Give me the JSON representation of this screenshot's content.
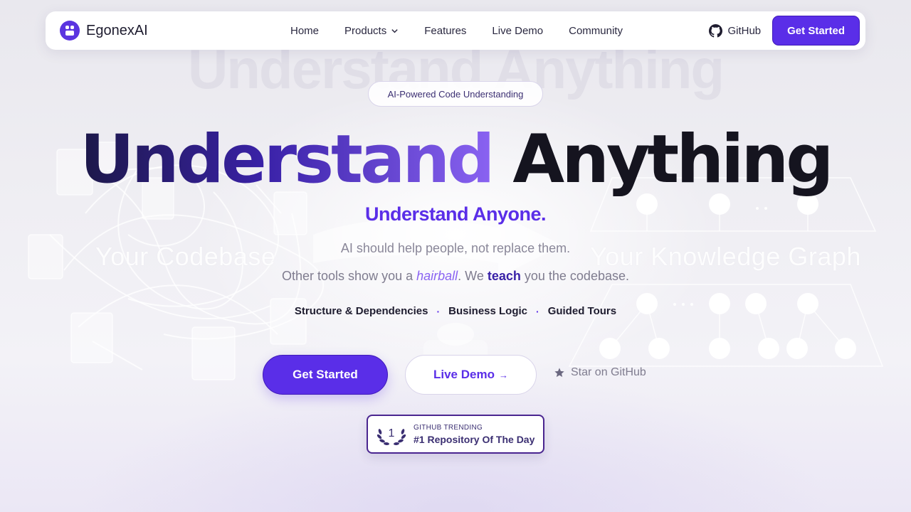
{
  "nav": {
    "brand": "EgonexAI",
    "links": [
      {
        "label": "Home"
      },
      {
        "label": "Products",
        "has_dropdown": true
      },
      {
        "label": "Features"
      },
      {
        "label": "Live Demo"
      },
      {
        "label": "Community"
      }
    ],
    "github_label": "GitHub",
    "cta_label": "Get Started"
  },
  "background": {
    "left_label": "Your Codebase",
    "right_label": "Your Knowledge Graph",
    "ghost_heading": "Understand Anything"
  },
  "hero": {
    "badge": "AI-Powered Code Understanding",
    "headline_part1": "Understand",
    "headline_part2": "Anything",
    "subheading": "Understand Anyone.",
    "tagline": "AI should help people, not replace them.",
    "tagline2": {
      "pre": "Other tools show you a ",
      "em": "hairball",
      "mid": ". We ",
      "strong": "teach",
      "post": " you the codebase."
    },
    "pillars": [
      "Structure & Dependencies",
      "Business Logic",
      "Guided Tours"
    ],
    "pillar_separator": "·",
    "primary_cta": "Get Started",
    "secondary_cta": "Live Demo",
    "secondary_cta_arrow": "→",
    "star_label": "Star on GitHub",
    "trending": {
      "rank": "1",
      "small": "GITHUB TRENDING",
      "big": "#1 Repository Of The Day"
    }
  },
  "colors": {
    "accent": "#5a2ee8",
    "accent_dark": "#3a22a8",
    "text_dark": "#15141f",
    "muted": "#7f7c8f"
  }
}
